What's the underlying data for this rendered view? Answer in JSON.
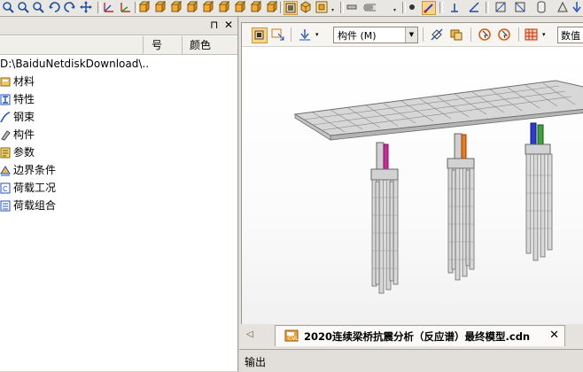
{
  "left_panel": {
    "pin_icon": "⊓",
    "close_icon": "✕",
    "columns": [
      "号",
      "颜色"
    ],
    "tree": {
      "root": "D:\\BaiduNetdiskDownload\\..",
      "items": [
        {
          "label": "材料",
          "icon": "materials-icon"
        },
        {
          "label": "特性",
          "icon": "properties-icon"
        },
        {
          "label": "钢束",
          "icon": "tendon-icon"
        },
        {
          "label": "构件",
          "icon": "member-icon"
        },
        {
          "label": "参数",
          "icon": "parameters-icon"
        },
        {
          "label": "边界条件",
          "icon": "boundary-icon"
        },
        {
          "label": "荷载工况",
          "icon": "load-case-icon"
        },
        {
          "label": "荷载组合",
          "icon": "load-combination-icon"
        }
      ]
    }
  },
  "view_toolbar": {
    "view_select_value": "构件 (M)",
    "value_label": "数值"
  },
  "doc_tab": {
    "label": "2020连续梁桥抗震分析（反应谱）最终模型.cdn",
    "close": "✕"
  },
  "output": {
    "label": "输出"
  },
  "colors": {
    "accent_pink": "#cc2a9a",
    "accent_orange": "#f07a13",
    "accent_blue": "#2b3ad0",
    "accent_green": "#3aa33a",
    "panel_bg": "#d4d0c8"
  }
}
